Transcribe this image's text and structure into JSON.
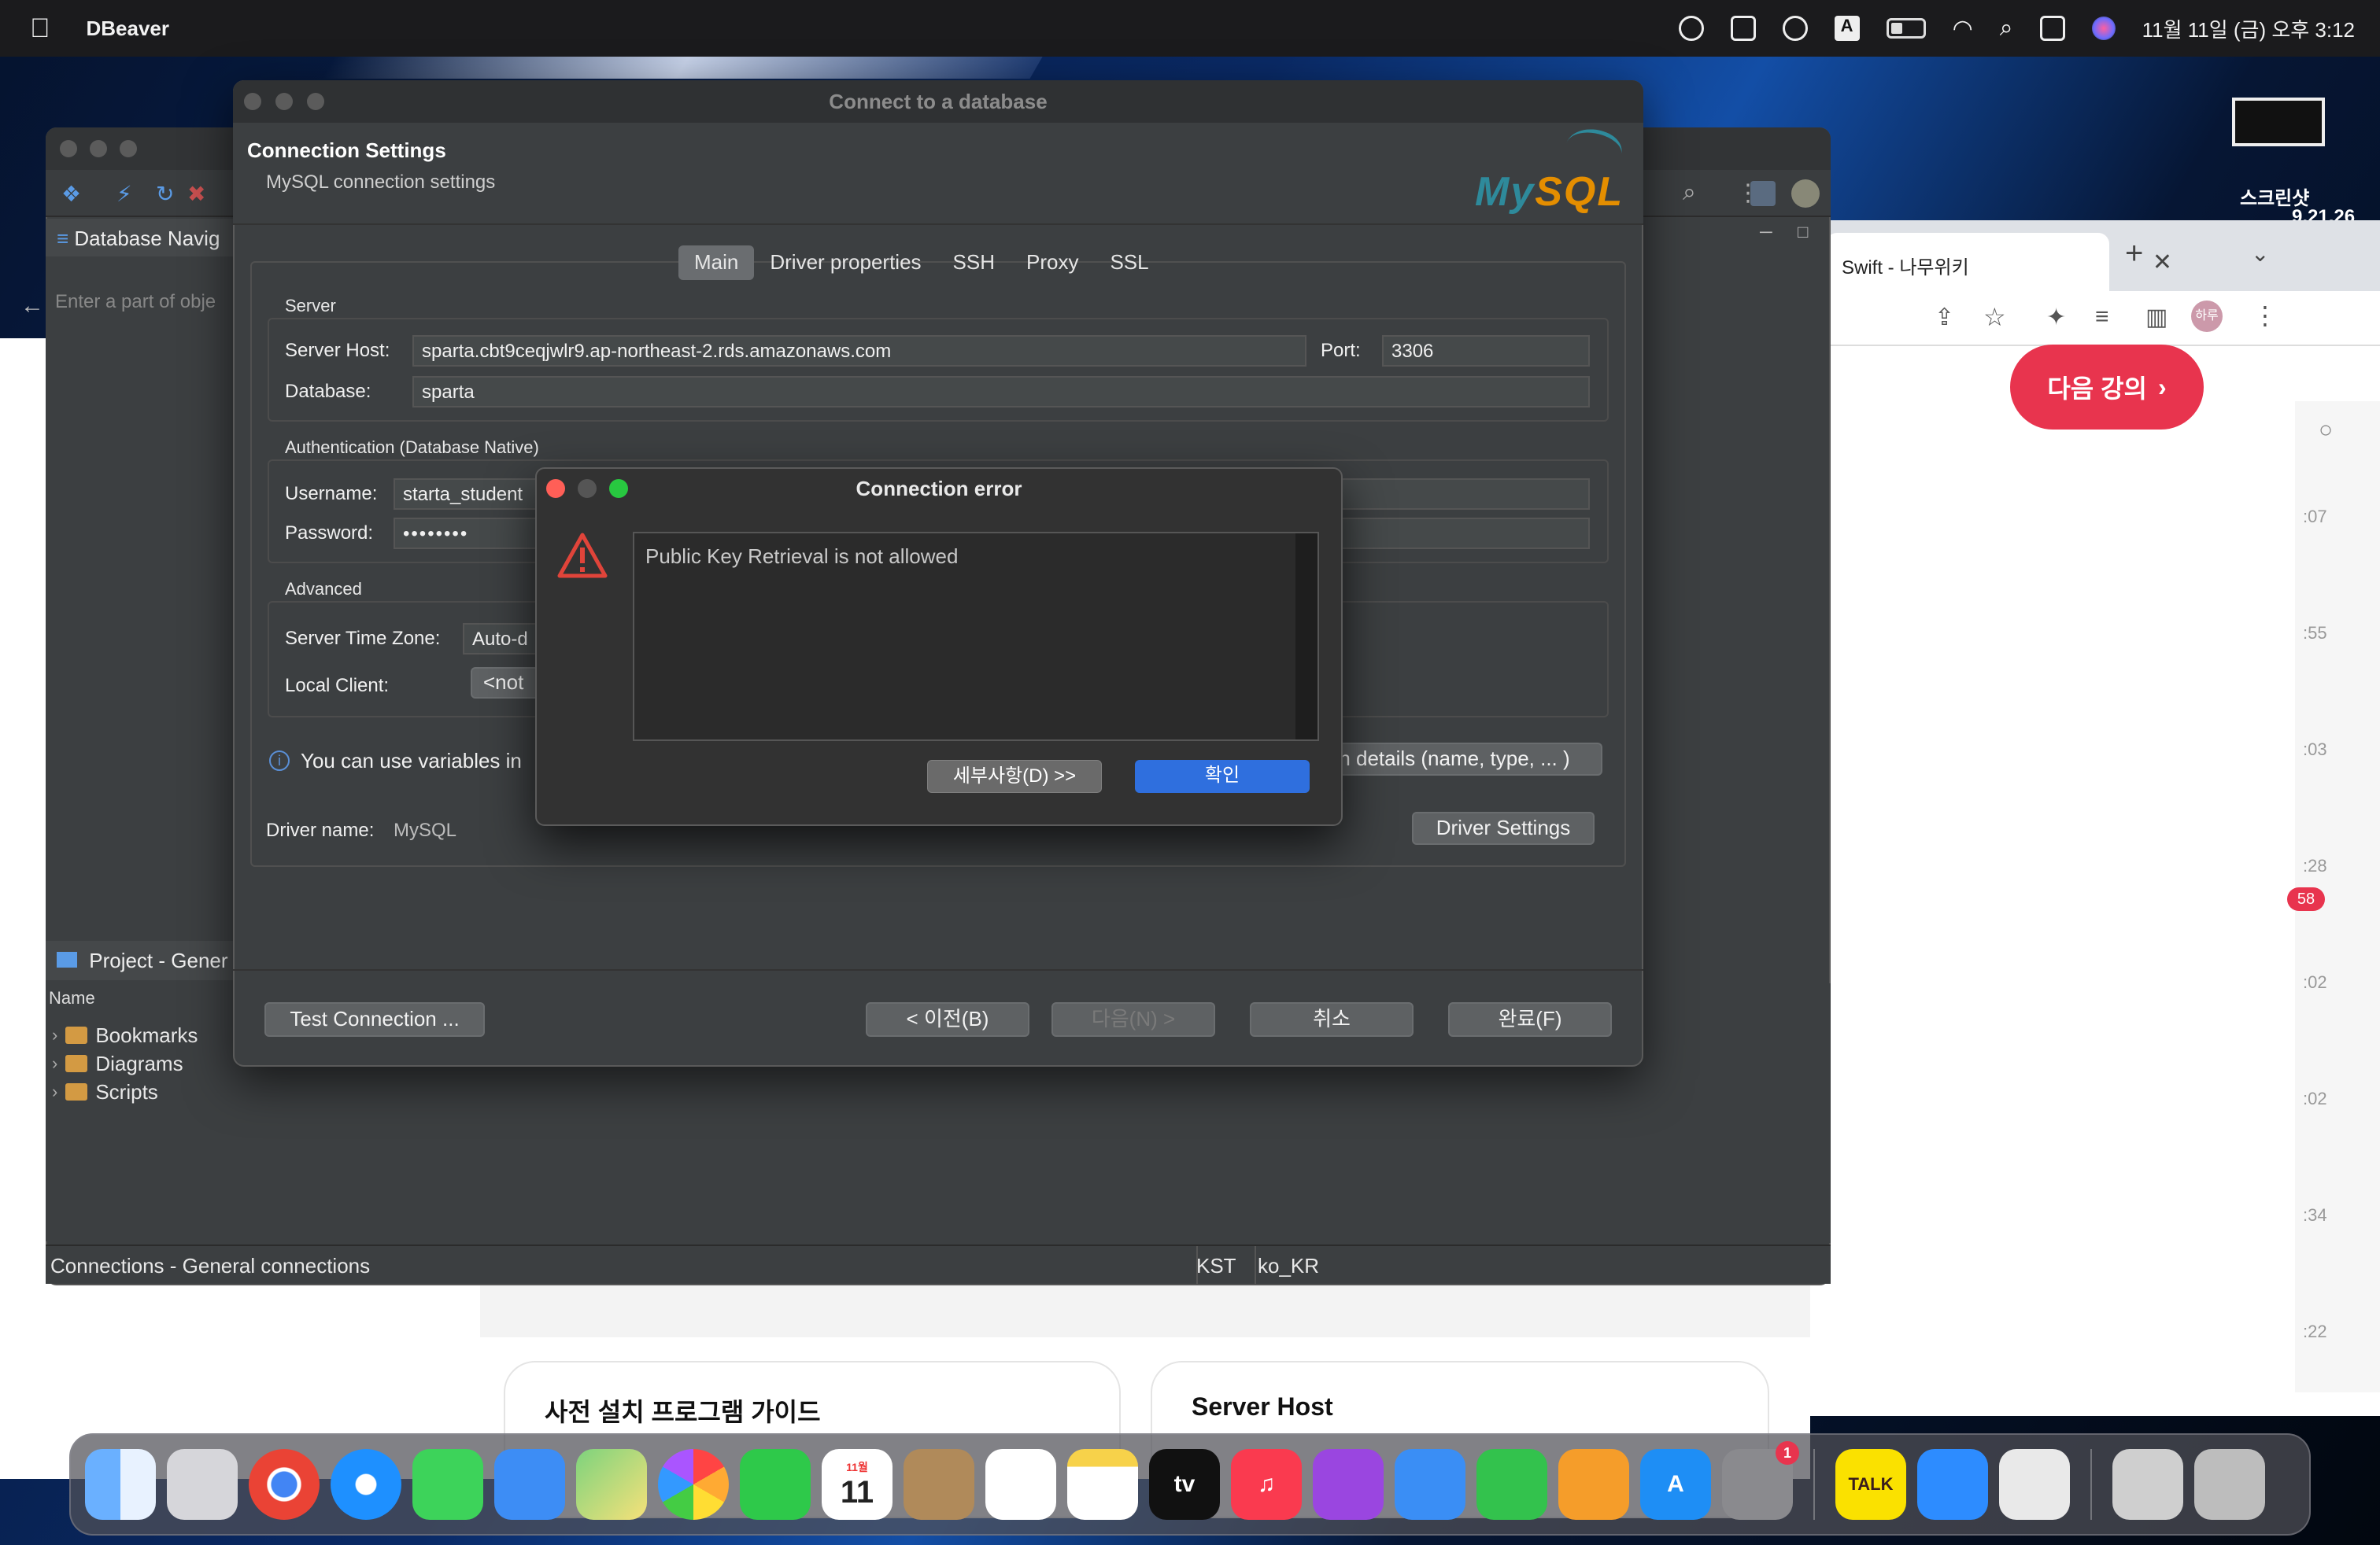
{
  "menubar": {
    "app_name": "DBeaver",
    "clock": "11월 11일 (금) 오후 3:12"
  },
  "desktop": {
    "screenshot_label": "스크린샷",
    "screenshot_sub": "9.21.26"
  },
  "browser": {
    "tab_title": "Swift - 나무위키",
    "next_lecture_button": "다음 강의",
    "sidebar_times": [
      ":07",
      ":55",
      ":03",
      ":28",
      ":02",
      ":02",
      ":34",
      ":22"
    ],
    "badge": "58"
  },
  "webpage": {
    "card1_title": "사전 설치 프로그램 가이드",
    "card2_title": "Server Host"
  },
  "dbeaver": {
    "nav_title": "Database Navig",
    "nav_search_placeholder": "Enter a part of obje",
    "project_title": "Project - Gener",
    "tree_column": "Name",
    "tree_items": [
      "Bookmarks",
      "Diagrams",
      "Scripts"
    ],
    "status_left": "Connections - General connections",
    "status_tz": "KST",
    "status_locale": "ko_KR"
  },
  "connect_dialog": {
    "title": "Connect to a database",
    "heading": "Connection Settings",
    "subheading": "MySQL connection settings",
    "logo_text_my": "My",
    "logo_text_sql": "SQL",
    "tabs": [
      "Main",
      "Driver properties",
      "SSH",
      "Proxy",
      "SSL"
    ],
    "active_tab": "Main",
    "server_section": "Server",
    "server_host_label": "Server Host:",
    "server_host_value": "sparta.cbt9ceqjwlr9.ap-northeast-2.rds.amazonaws.com",
    "port_label": "Port:",
    "port_value": "3306",
    "database_label": "Database:",
    "database_value": "sparta",
    "auth_section": "Authentication (Database Native)",
    "username_label": "Username:",
    "username_value": "starta_student",
    "password_label": "Password:",
    "password_value": "••••••••",
    "advanced_section": "Advanced",
    "timezone_label": "Server Time Zone:",
    "timezone_value": "Auto-d",
    "local_client_label": "Local Client:",
    "local_client_value": "<not",
    "variables_info": "You can use variables in",
    "details_button": "n details (name, type, ... )",
    "driver_name_label": "Driver name:",
    "driver_name_value": "MySQL",
    "driver_settings_button": "Driver Settings",
    "test_connection_button": "Test Connection ...",
    "back_button": "< 이전(B)",
    "next_button": "다음(N) >",
    "cancel_button": "취소",
    "finish_button": "완료(F)"
  },
  "error_dialog": {
    "title": "Connection error",
    "message": "Public Key Retrieval is not allowed",
    "details_button": "세부사항(D) >>",
    "ok_button": "확인"
  },
  "dock": {
    "calendar_day": "11",
    "calendar_month": "11월",
    "settings_badge": "1",
    "talk_label": "TALK",
    "tv_label": "tv"
  },
  "colors": {
    "accent_blue": "#2f6fde",
    "error_red": "#e8344e",
    "dialog_bg": "#3c3f41"
  }
}
